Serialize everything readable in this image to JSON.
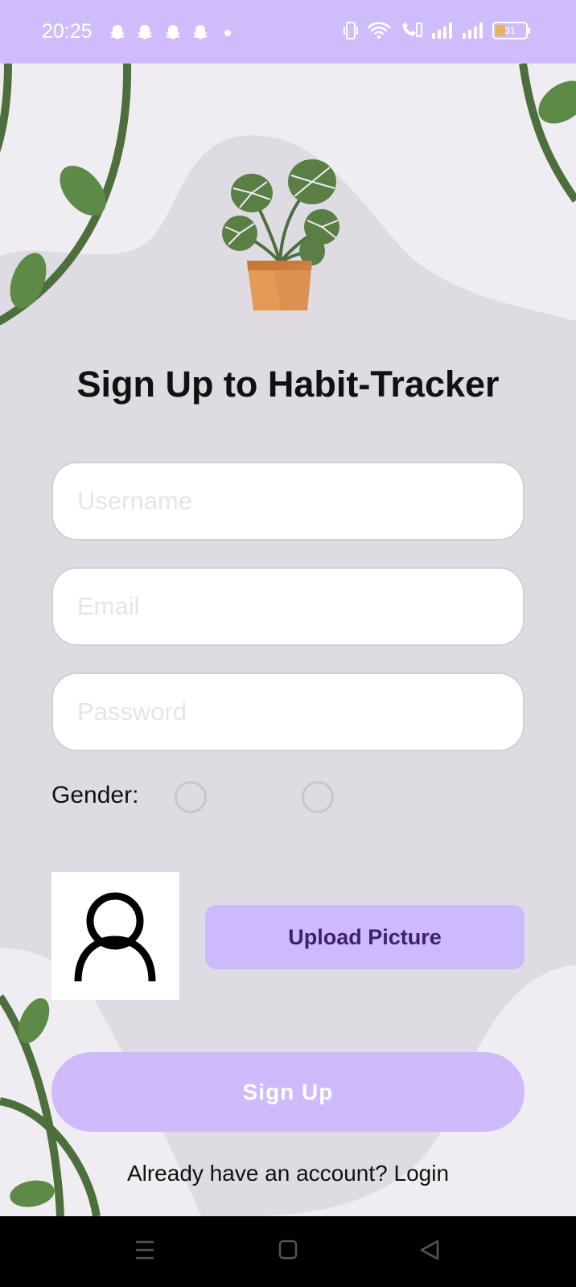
{
  "status_bar": {
    "time": "20:25",
    "notification_icons": [
      "snapchat-icon",
      "snapchat-icon",
      "snapchat-icon",
      "snapchat-icon",
      "dot-icon"
    ],
    "system_icons": [
      "vibrate-icon",
      "wifi-icon",
      "wifi-call-icon",
      "signal-icon",
      "signal-icon"
    ],
    "battery": "31",
    "background_color": "#cfbdfb"
  },
  "header": {
    "logo_icon": "plant-pot-icon",
    "title": "Sign Up to Habit-Tracker"
  },
  "form": {
    "username": {
      "placeholder": "Username",
      "value": ""
    },
    "email": {
      "placeholder": "Email",
      "value": ""
    },
    "password": {
      "placeholder": "Password",
      "value": ""
    },
    "gender_label": "Gender:",
    "gender_options": [
      {
        "label": "",
        "selected": false
      },
      {
        "label": "",
        "selected": false
      }
    ],
    "avatar_icon": "user-icon",
    "upload_label": "Upload Picture",
    "submit_label": "Sign Up",
    "login_prompt": "Already have an account? Login"
  },
  "colors": {
    "accent": "#cdbafc",
    "accent_text": "#3b2270",
    "leaf": "#4d6e3d",
    "pot": "#e29a55",
    "background": "#efedf2",
    "blob": "#dedce2"
  },
  "nav_bar": {
    "icons": [
      "menu-icon",
      "home-icon",
      "back-icon"
    ]
  }
}
